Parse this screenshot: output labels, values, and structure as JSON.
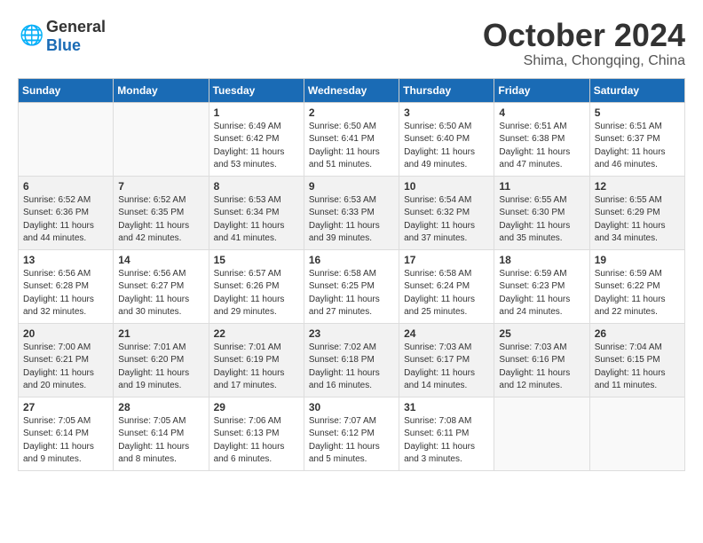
{
  "logo": {
    "general": "General",
    "blue": "Blue"
  },
  "title": "October 2024",
  "location": "Shima, Chongqing, China",
  "days_header": [
    "Sunday",
    "Monday",
    "Tuesday",
    "Wednesday",
    "Thursday",
    "Friday",
    "Saturday"
  ],
  "weeks": [
    {
      "shaded": false,
      "days": [
        {
          "num": "",
          "info": ""
        },
        {
          "num": "",
          "info": ""
        },
        {
          "num": "1",
          "info": "Sunrise: 6:49 AM\nSunset: 6:42 PM\nDaylight: 11 hours and 53 minutes."
        },
        {
          "num": "2",
          "info": "Sunrise: 6:50 AM\nSunset: 6:41 PM\nDaylight: 11 hours and 51 minutes."
        },
        {
          "num": "3",
          "info": "Sunrise: 6:50 AM\nSunset: 6:40 PM\nDaylight: 11 hours and 49 minutes."
        },
        {
          "num": "4",
          "info": "Sunrise: 6:51 AM\nSunset: 6:38 PM\nDaylight: 11 hours and 47 minutes."
        },
        {
          "num": "5",
          "info": "Sunrise: 6:51 AM\nSunset: 6:37 PM\nDaylight: 11 hours and 46 minutes."
        }
      ]
    },
    {
      "shaded": true,
      "days": [
        {
          "num": "6",
          "info": "Sunrise: 6:52 AM\nSunset: 6:36 PM\nDaylight: 11 hours and 44 minutes."
        },
        {
          "num": "7",
          "info": "Sunrise: 6:52 AM\nSunset: 6:35 PM\nDaylight: 11 hours and 42 minutes."
        },
        {
          "num": "8",
          "info": "Sunrise: 6:53 AM\nSunset: 6:34 PM\nDaylight: 11 hours and 41 minutes."
        },
        {
          "num": "9",
          "info": "Sunrise: 6:53 AM\nSunset: 6:33 PM\nDaylight: 11 hours and 39 minutes."
        },
        {
          "num": "10",
          "info": "Sunrise: 6:54 AM\nSunset: 6:32 PM\nDaylight: 11 hours and 37 minutes."
        },
        {
          "num": "11",
          "info": "Sunrise: 6:55 AM\nSunset: 6:30 PM\nDaylight: 11 hours and 35 minutes."
        },
        {
          "num": "12",
          "info": "Sunrise: 6:55 AM\nSunset: 6:29 PM\nDaylight: 11 hours and 34 minutes."
        }
      ]
    },
    {
      "shaded": false,
      "days": [
        {
          "num": "13",
          "info": "Sunrise: 6:56 AM\nSunset: 6:28 PM\nDaylight: 11 hours and 32 minutes."
        },
        {
          "num": "14",
          "info": "Sunrise: 6:56 AM\nSunset: 6:27 PM\nDaylight: 11 hours and 30 minutes."
        },
        {
          "num": "15",
          "info": "Sunrise: 6:57 AM\nSunset: 6:26 PM\nDaylight: 11 hours and 29 minutes."
        },
        {
          "num": "16",
          "info": "Sunrise: 6:58 AM\nSunset: 6:25 PM\nDaylight: 11 hours and 27 minutes."
        },
        {
          "num": "17",
          "info": "Sunrise: 6:58 AM\nSunset: 6:24 PM\nDaylight: 11 hours and 25 minutes."
        },
        {
          "num": "18",
          "info": "Sunrise: 6:59 AM\nSunset: 6:23 PM\nDaylight: 11 hours and 24 minutes."
        },
        {
          "num": "19",
          "info": "Sunrise: 6:59 AM\nSunset: 6:22 PM\nDaylight: 11 hours and 22 minutes."
        }
      ]
    },
    {
      "shaded": true,
      "days": [
        {
          "num": "20",
          "info": "Sunrise: 7:00 AM\nSunset: 6:21 PM\nDaylight: 11 hours and 20 minutes."
        },
        {
          "num": "21",
          "info": "Sunrise: 7:01 AM\nSunset: 6:20 PM\nDaylight: 11 hours and 19 minutes."
        },
        {
          "num": "22",
          "info": "Sunrise: 7:01 AM\nSunset: 6:19 PM\nDaylight: 11 hours and 17 minutes."
        },
        {
          "num": "23",
          "info": "Sunrise: 7:02 AM\nSunset: 6:18 PM\nDaylight: 11 hours and 16 minutes."
        },
        {
          "num": "24",
          "info": "Sunrise: 7:03 AM\nSunset: 6:17 PM\nDaylight: 11 hours and 14 minutes."
        },
        {
          "num": "25",
          "info": "Sunrise: 7:03 AM\nSunset: 6:16 PM\nDaylight: 11 hours and 12 minutes."
        },
        {
          "num": "26",
          "info": "Sunrise: 7:04 AM\nSunset: 6:15 PM\nDaylight: 11 hours and 11 minutes."
        }
      ]
    },
    {
      "shaded": false,
      "days": [
        {
          "num": "27",
          "info": "Sunrise: 7:05 AM\nSunset: 6:14 PM\nDaylight: 11 hours and 9 minutes."
        },
        {
          "num": "28",
          "info": "Sunrise: 7:05 AM\nSunset: 6:14 PM\nDaylight: 11 hours and 8 minutes."
        },
        {
          "num": "29",
          "info": "Sunrise: 7:06 AM\nSunset: 6:13 PM\nDaylight: 11 hours and 6 minutes."
        },
        {
          "num": "30",
          "info": "Sunrise: 7:07 AM\nSunset: 6:12 PM\nDaylight: 11 hours and 5 minutes."
        },
        {
          "num": "31",
          "info": "Sunrise: 7:08 AM\nSunset: 6:11 PM\nDaylight: 11 hours and 3 minutes."
        },
        {
          "num": "",
          "info": ""
        },
        {
          "num": "",
          "info": ""
        }
      ]
    }
  ]
}
